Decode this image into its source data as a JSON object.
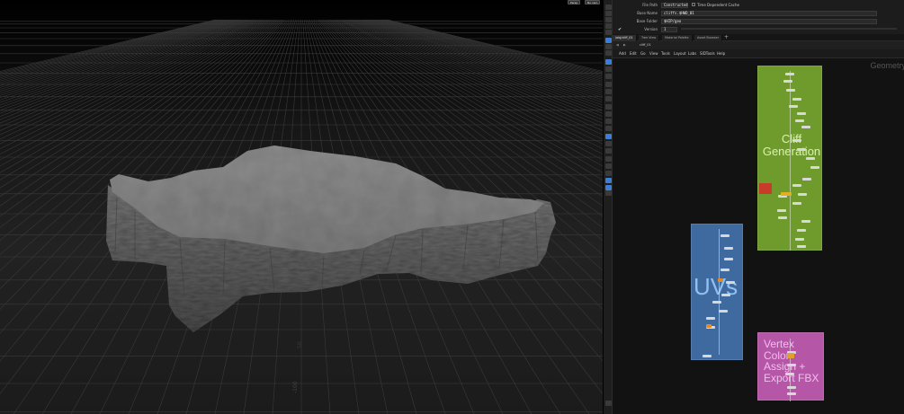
{
  "viewport": {
    "buttons": [
      "Persp",
      "No cam"
    ],
    "axis_labels": [
      "-100",
      "50"
    ]
  },
  "params": {
    "file_path_label": "File Path",
    "file_path_mode": "Constructed",
    "time_dependent_label": "Time Dependent Cache",
    "base_name_label": "Base Name",
    "base_name_value": "cliffs.$HWD_01",
    "base_folder_label": "Base Folder",
    "base_folder_value": "$HIP/geo",
    "version_label": "Version",
    "version_value": "1"
  },
  "tabs": [
    "/obj/cliff_01",
    "Tree View",
    "Material Palette",
    "Asset Browser"
  ],
  "path": "cliff_01",
  "menu": [
    "Add",
    "Edit",
    "Go",
    "View",
    "Tools",
    "Layout",
    "Labs",
    "SIDTools",
    "Help"
  ],
  "network": {
    "context_label": "Geometry",
    "boxes": [
      {
        "label": "Cliff\nGeneration",
        "color": "#6f9b2c",
        "text_color": "#d8f3a8"
      },
      {
        "label": "UVs",
        "color": "#3f6aa0",
        "text_color": "#8fc0f0"
      },
      {
        "label": "Vertex\nColor\nAssign +\nExport FBX",
        "color": "#b557a6",
        "text_color": "#f2bff0"
      }
    ]
  },
  "colors": {
    "accent": "#3e7dd6",
    "green_box": "#6f9b2c",
    "blue_box": "#3f6aa0",
    "pink_box": "#b557a6"
  }
}
